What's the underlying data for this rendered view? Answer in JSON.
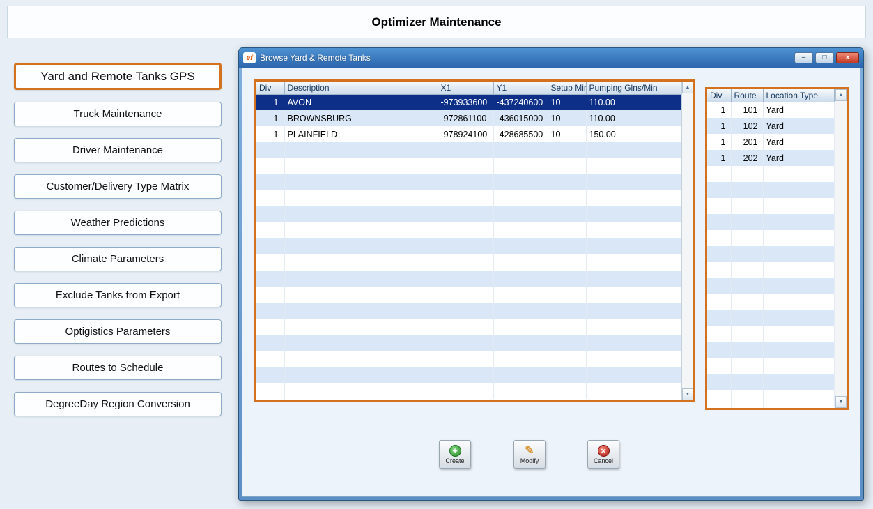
{
  "header": {
    "title": "Optimizer Maintenance"
  },
  "sidebar": {
    "items": [
      {
        "label": "Yard and Remote Tanks GPS",
        "active": true
      },
      {
        "label": "Truck Maintenance",
        "active": false
      },
      {
        "label": "Driver Maintenance",
        "active": false
      },
      {
        "label": "Customer/Delivery Type Matrix",
        "active": false
      },
      {
        "label": "Weather Predictions",
        "active": false
      },
      {
        "label": "Climate Parameters",
        "active": false
      },
      {
        "label": "Exclude Tanks from Export",
        "active": false
      },
      {
        "label": "Optigistics Parameters",
        "active": false
      },
      {
        "label": "Routes to Schedule",
        "active": false
      },
      {
        "label": "DegreeDay Region Conversion",
        "active": false
      }
    ]
  },
  "window": {
    "title": "Browse Yard & Remote Tanks",
    "icon_label": "ef",
    "controls": {
      "minimize_glyph": "–",
      "maximize_glyph": "□",
      "close_glyph": "×"
    }
  },
  "tanks_table": {
    "columns": [
      "Div",
      "Description",
      "X1",
      "Y1",
      "Setup Mins",
      "Pumping Glns/Min"
    ],
    "rows": [
      [
        "1",
        "AVON",
        "-973933600",
        "-437240600",
        "10",
        "110.00"
      ],
      [
        "1",
        "BROWNSBURG",
        "-972861100",
        "-436015000",
        "10",
        "110.00"
      ],
      [
        "1",
        "PLAINFIELD",
        "-978924100",
        "-428685500",
        "10",
        "150.00"
      ]
    ],
    "selected_row_index": 0,
    "empty_row_count": 16
  },
  "routes_table": {
    "columns": [
      "Div",
      "Route",
      "Location Type"
    ],
    "rows": [
      [
        "1",
        "101",
        "Yard"
      ],
      [
        "1",
        "102",
        "Yard"
      ],
      [
        "1",
        "201",
        "Yard"
      ],
      [
        "1",
        "202",
        "Yard"
      ]
    ],
    "selected_row_index": -1,
    "empty_row_count": 15
  },
  "actions": {
    "create": {
      "label": "Create"
    },
    "modify": {
      "label": "Modify"
    },
    "cancel": {
      "label": "Cancel"
    }
  },
  "icons": {
    "up_arrow": "▲",
    "down_arrow": "▼",
    "plus": "+",
    "pencil": "✎",
    "cross": "×"
  },
  "colors": {
    "accent_orange": "#d4711f",
    "selected_row": "#0d2f87",
    "titlebar_top": "#4e92d2",
    "titlebar_bottom": "#2b66ae"
  }
}
